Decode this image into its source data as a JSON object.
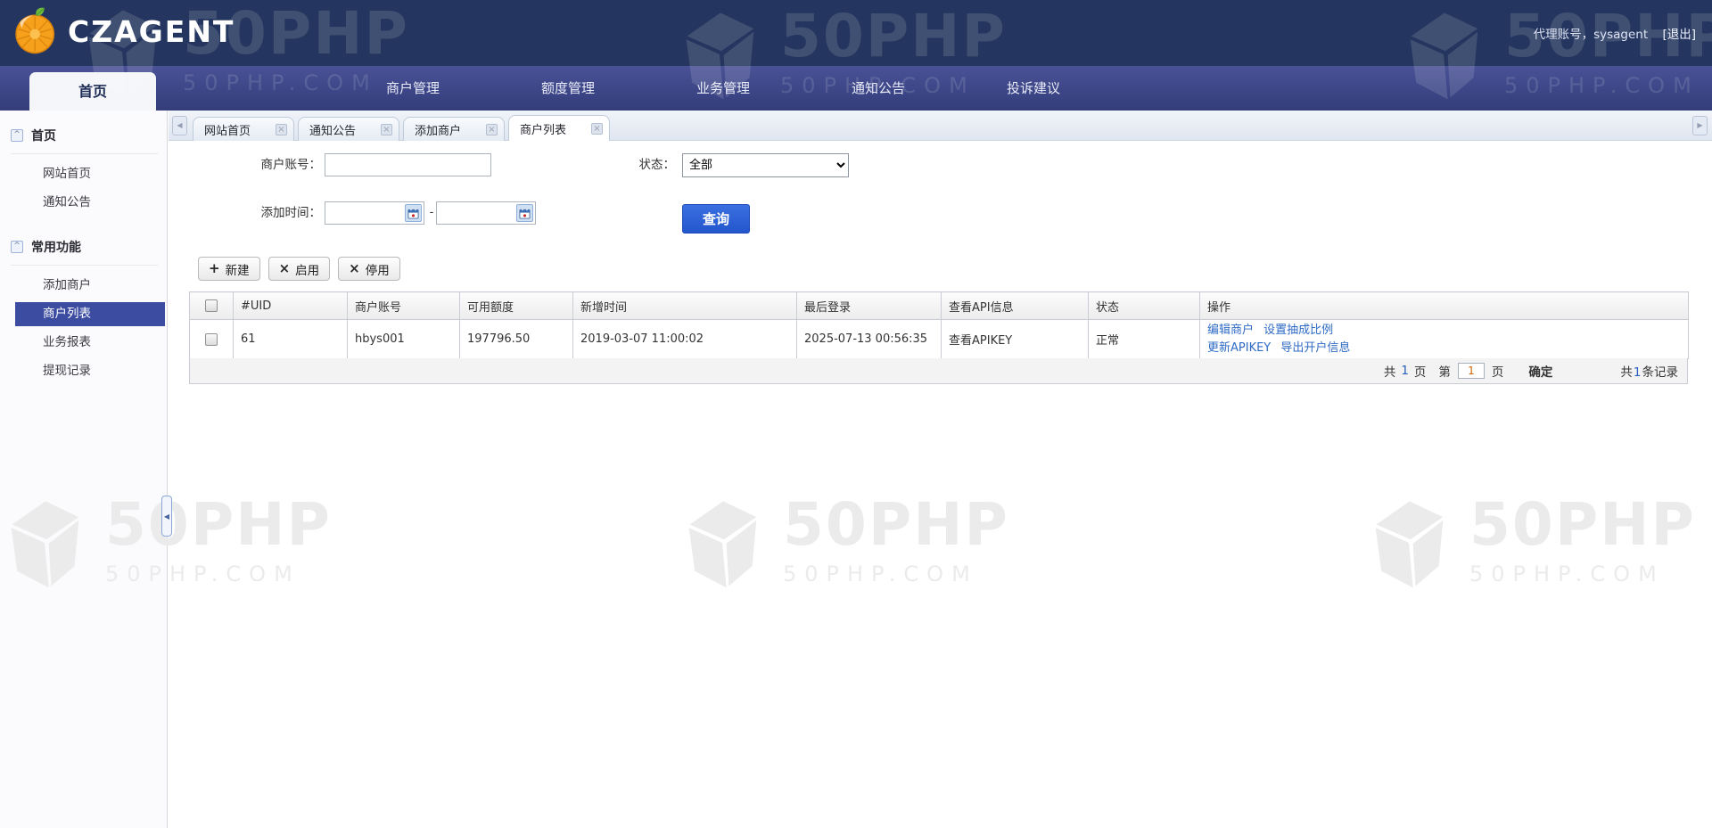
{
  "app": {
    "logo_text": "CZAGENT"
  },
  "header": {
    "user_info": "代理账号，sysagent",
    "logout": "[退出]"
  },
  "nav": {
    "items": [
      {
        "label": "首页",
        "active": true
      },
      {
        "label": "商户管理"
      },
      {
        "label": "额度管理"
      },
      {
        "label": "业务管理"
      },
      {
        "label": "通知公告"
      },
      {
        "label": "投诉建议"
      }
    ]
  },
  "sidebar": {
    "sections": [
      {
        "title": "首页",
        "items": [
          {
            "label": "网站首页"
          },
          {
            "label": "通知公告"
          }
        ]
      },
      {
        "title": "常用功能",
        "items": [
          {
            "label": "添加商户"
          },
          {
            "label": "商户列表",
            "active": true
          },
          {
            "label": "业务报表"
          },
          {
            "label": "提现记录"
          }
        ]
      }
    ]
  },
  "tabs": {
    "items": [
      {
        "label": "网站首页"
      },
      {
        "label": "通知公告"
      },
      {
        "label": "添加商户"
      },
      {
        "label": "商户列表",
        "active": true
      }
    ]
  },
  "filter": {
    "account_label": "商户账号：",
    "status_label": "状态：",
    "status_value": "全部",
    "time_label": "添加时间：",
    "date_separator": "-",
    "search_button": "查询"
  },
  "toolbar": {
    "new_label": "新建",
    "enable_label": "启用",
    "disable_label": "停用"
  },
  "table": {
    "columns": [
      "#UID",
      "商户账号",
      "可用额度",
      "新增时间",
      "最后登录",
      "查看API信息",
      "状态",
      "操作"
    ],
    "rows": [
      {
        "uid": "61",
        "account": "hbys001",
        "quota": "197796.50",
        "created": "2019-03-07 11:00:02",
        "last_login": "2025-07-13 00:56:35",
        "api_link": "查看APIKEY",
        "status": "正常",
        "actions": [
          "编辑商户",
          "设置抽成比例",
          "更新APIKEY",
          "导出开户信息"
        ]
      }
    ]
  },
  "pagination": {
    "total_prefix": "共",
    "total_pages": "1",
    "page_word": "页",
    "current_prefix": "第",
    "current_page": "1",
    "confirm": "确定",
    "records_prefix": "共",
    "records_count": "1",
    "records_suffix": "条记录"
  },
  "watermark": {
    "title": "50PHP",
    "domain": "50PHP.COM"
  },
  "icons": {
    "close": "×",
    "plus": "+",
    "cross": "×",
    "scroll_left": "◀",
    "scroll_right": "▶",
    "collapse_left": "◀",
    "section_toggle": "^"
  },
  "colors": {
    "header_bg": "#24365f",
    "nav_bg": "#3d4687",
    "active_item_bg": "#3c4da1",
    "query_button": "#2a5fd6",
    "link": "#2f6bc5"
  }
}
